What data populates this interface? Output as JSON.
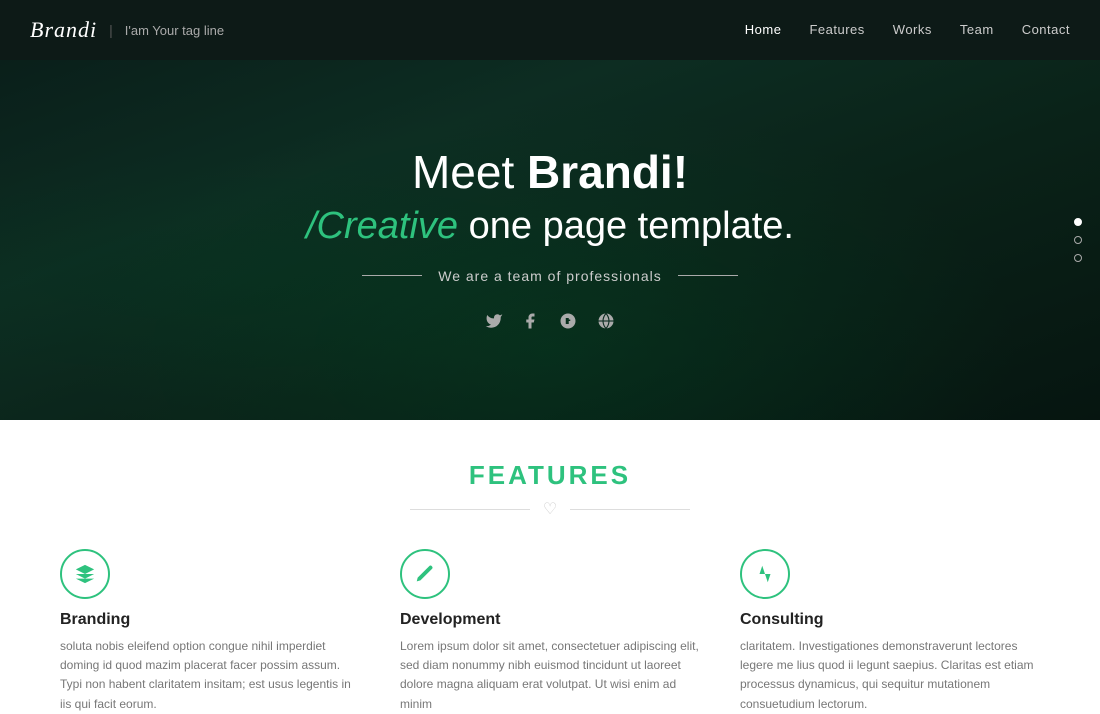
{
  "navbar": {
    "brand": "Brandi",
    "separator": "|",
    "tagline": "I'am Your tag line",
    "nav_items": [
      {
        "label": "Home",
        "active": true
      },
      {
        "label": "Features",
        "active": false
      },
      {
        "label": "Works",
        "active": false
      },
      {
        "label": "Team",
        "active": false
      },
      {
        "label": "Contact",
        "active": false
      }
    ]
  },
  "hero": {
    "title_normal": "Meet ",
    "title_bold": "Brandi!",
    "subtitle_colored": "/Creative",
    "subtitle_rest": " one page template.",
    "divider_text": "We are a team of professionals",
    "social_icons": [
      {
        "name": "twitter",
        "symbol": "𝕥"
      },
      {
        "name": "facebook",
        "symbol": "f"
      },
      {
        "name": "google-plus",
        "symbol": "g⁺"
      },
      {
        "name": "globe",
        "symbol": "⊕"
      }
    ],
    "scroll_dots": [
      {
        "active": true
      },
      {
        "active": false
      },
      {
        "active": false
      }
    ]
  },
  "features": {
    "section_title": "FEATURES",
    "items": [
      {
        "name": "Branding",
        "icon": "branding",
        "description": "soluta nobis eleifend option congue nihil imperdiet doming id quod mazim placerat facer possim assum. Typi non habent claritatem insitam; est usus legentis in iis qui facit eorum."
      },
      {
        "name": "Development",
        "icon": "development",
        "description": "Lorem ipsum dolor sit amet, consectetuer adipiscing elit, sed diam nonummy nibh euismod tincidunt ut laoreet dolore magna aliquam erat volutpat. Ut wisi enim ad minim"
      },
      {
        "name": "Consulting",
        "icon": "consulting",
        "description": "claritatem. Investigationes demonstraverunt lectores legere me lius quod ii legunt saepius. Claritas est etiam processus dynamicus, qui sequitur mutationem consuetudium lectorum."
      }
    ]
  }
}
